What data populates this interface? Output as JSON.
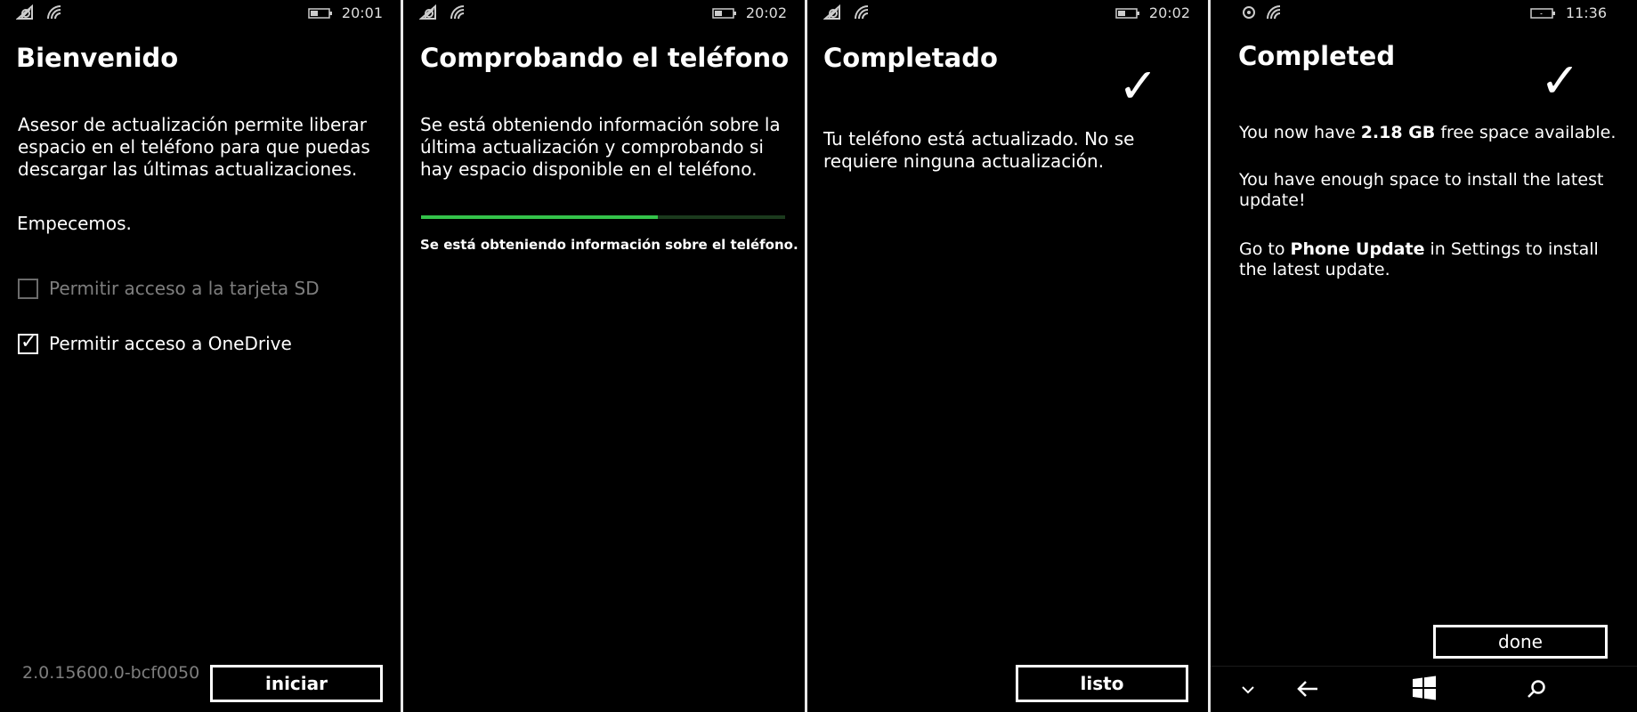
{
  "screens": [
    {
      "status": {
        "time": "20:01"
      },
      "title": "Bienvenido",
      "body": "Asesor de actualización permite liberar espacio en el teléfono para que puedas descargar las últimas actualizaciones.",
      "subtitle": "Empecemos.",
      "options": [
        {
          "label": "Permitir acceso a la tarjeta SD",
          "checked": false,
          "enabled": false
        },
        {
          "label": "Permitir acceso a OneDrive",
          "checked": true,
          "enabled": true
        }
      ],
      "version": "2.0.15600.0-bcf0050",
      "button": "iniciar"
    },
    {
      "status": {
        "time": "20:02"
      },
      "title": "Comprobando el teléfono",
      "body": "Se está obteniendo información sobre la última actualización y comprobando si hay espacio disponible en el teléfono.",
      "progress": 0.65,
      "progress_label": "Se está obteniendo información sobre el teléfono."
    },
    {
      "status": {
        "time": "20:02"
      },
      "title": "Completado",
      "check_glyph": "✓",
      "body": "Tu teléfono está actualizado. No se requiere ninguna actualización.",
      "button": "listo"
    },
    {
      "status": {
        "time": "11:36"
      },
      "title": "Completed",
      "check_glyph": "✓",
      "line1": {
        "prefix": "You now have ",
        "strong": "2.18 GB",
        "suffix": " free space available."
      },
      "line2": "You have enough space to install the latest update!",
      "line3": {
        "prefix": "Go to ",
        "strong": "Phone Update",
        "suffix": " in Settings to install the latest update."
      },
      "button": "done",
      "nav": [
        "chevron-down-icon",
        "back-arrow-icon",
        "windows-start-icon",
        "search-icon"
      ]
    }
  ],
  "colors": {
    "accent": "#34c34a",
    "disabled": "#7e7e7e",
    "background": "#000000"
  }
}
